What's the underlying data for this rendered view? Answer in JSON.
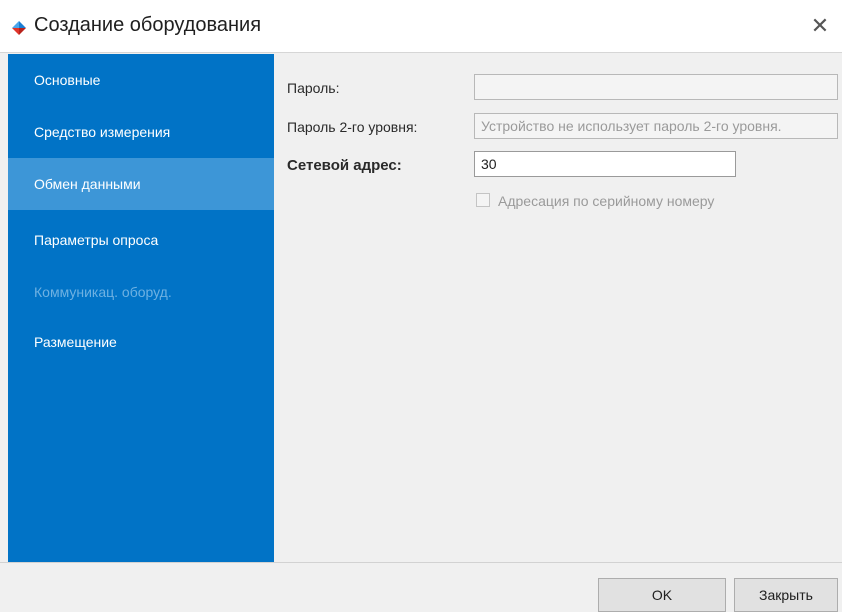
{
  "window": {
    "title": "Создание оборудования",
    "close_symbol": "✕",
    "app_icon": "diamond-logo-icon",
    "colors": {
      "logo_top": "#1a7fd4",
      "logo_bottom": "#e0352b",
      "sidebar": "#0173c6",
      "sidebar_active": "#3d96d7"
    }
  },
  "sidebar": {
    "items": [
      {
        "label": "Основные",
        "state": "normal"
      },
      {
        "label": "Средство измерения",
        "state": "normal"
      },
      {
        "label": "Обмен данными",
        "state": "active"
      },
      {
        "label": "Параметры опроса",
        "state": "normal"
      },
      {
        "label": "Коммуникац. оборуд.",
        "state": "disabled"
      },
      {
        "label": "Размещение",
        "state": "normal"
      }
    ]
  },
  "form": {
    "password_label": "Пароль:",
    "password_value": "",
    "password2_label": "Пароль 2-го уровня:",
    "password2_value": "Устройство не использует пароль 2-го уровня.",
    "network_address_label": "Сетевой адрес:",
    "network_address_value": "30",
    "serial_addressing_label": "Адресация по серийному номеру",
    "serial_addressing_checked": false
  },
  "footer": {
    "ok_label": "OK",
    "close_label": "Закрыть"
  }
}
